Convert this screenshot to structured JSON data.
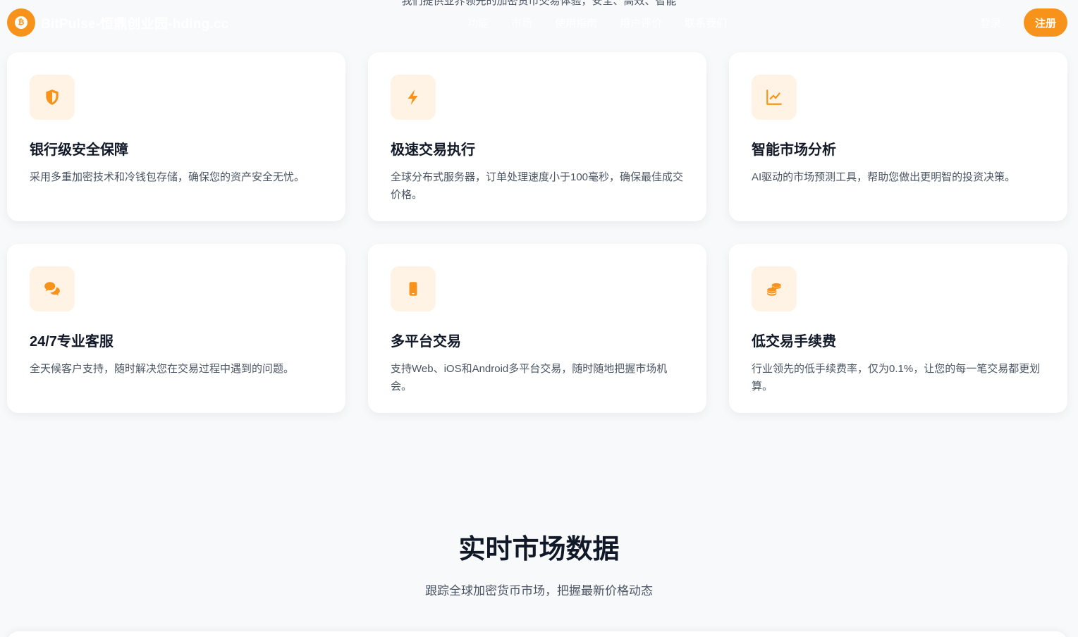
{
  "intro": {
    "text": "我们提供业界领先的加密货币交易体验，安全、高效、智能"
  },
  "header": {
    "brand": "BitPulse-恒鼎创业园-hding.cc",
    "logo_symbol": "₿",
    "nav": [
      "功能",
      "市场",
      "使用指南",
      "用户评价",
      "联系我们"
    ],
    "login": "登录",
    "register": "注册"
  },
  "features": [
    {
      "icon": "shield-icon",
      "title": "银行级安全保障",
      "desc": "采用多重加密技术和冷钱包存储，确保您的资产安全无忧。"
    },
    {
      "icon": "lightning-icon",
      "title": "极速交易执行",
      "desc": "全球分布式服务器，订单处理速度小于100毫秒，确保最佳成交价格。"
    },
    {
      "icon": "chart-line-icon",
      "title": "智能市场分析",
      "desc": "AI驱动的市场预测工具，帮助您做出更明智的投资决策。"
    },
    {
      "icon": "chat-bubbles-icon",
      "title": "24/7专业客服",
      "desc": "全天候客户支持，随时解决您在交易过程中遇到的问题。"
    },
    {
      "icon": "mobile-icon",
      "title": "多平台交易",
      "desc": "支持Web、iOS和Android多平台交易，随时随地把握市场机会。"
    },
    {
      "icon": "coins-icon",
      "title": "低交易手续费",
      "desc": "行业领先的低手续费率，仅为0.1%，让您的每一笔交易都更划算。"
    }
  ],
  "market": {
    "title": "实时市场数据",
    "subtitle": "跟踪全球加密货币市场，把握最新价格动态"
  },
  "colors": {
    "accent": "#f7931a",
    "icon_bg": "#fff3e6"
  }
}
